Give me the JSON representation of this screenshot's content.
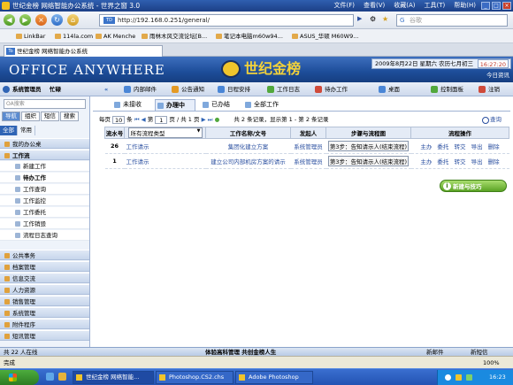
{
  "browser": {
    "title": "世纪金榜 网络智能办公系统 - 世界之窗 3.0",
    "menu": [
      "文件(F)",
      "查看(V)",
      "收藏(A)",
      "工具(T)",
      "帮助(H)"
    ],
    "url": "http://192.168.0.251/general/",
    "search_placeholder": "谷歌",
    "bookmarks": [
      "LinkBar",
      "114la.com",
      "AK Menche",
      "雨林木风交流论坛[B...",
      "笔记本电脑m60w94...",
      "ASUS_华硕 M60W9..."
    ],
    "tab_label": "世纪金榜 网络智能办公系统",
    "status_left": "完成",
    "status_right": "100%"
  },
  "app": {
    "logo": "OFFICE ANYWHERE",
    "brand": "世纪金榜",
    "date": "2009年8月22日 星期六 农历七月初三",
    "time": "16:27:20",
    "today_link": "今日资讯",
    "user_title": "系统管理员",
    "user_home": "忙碌"
  },
  "toolbar": {
    "items": [
      "内部邮件",
      "公告通知",
      "日程安排",
      "工作日志",
      "待办工作"
    ],
    "right": [
      "桌面",
      "控制面板",
      "注销"
    ]
  },
  "leftnav": {
    "search_placeholder": "OA搜索",
    "tabs": [
      "导航",
      "组织",
      "短信",
      "搜索"
    ],
    "subtabs": [
      "全部",
      "常用"
    ],
    "groups_top": [
      "我的办公桌",
      "工作流"
    ],
    "workflow_items": [
      "新建工作",
      "待办工作",
      "工作查询",
      "工作监控",
      "工作委托",
      "工作销毁",
      "流程日志查询"
    ],
    "groups_bottom": [
      "公共事务",
      "档案管理",
      "信息交流",
      "人力资源",
      "销售管理",
      "系统管理",
      "附件程序",
      "短讯管理"
    ]
  },
  "main": {
    "tabs": [
      "未接收",
      "办理中",
      "已办结",
      "全部工作"
    ],
    "pager": {
      "per_page_label": "每页",
      "per_page": "10",
      "unit": "条",
      "page_label": "第",
      "page": "1",
      "pages_text": "页 / 共 1 页",
      "summary": "共 2 条记录，显示第 1 - 第 2 条记录"
    },
    "query_label": "查询",
    "columns": [
      "流水号",
      "所有流程类型",
      "工作名称/文号",
      "发起人",
      "步骤与流程图",
      "流程操作"
    ],
    "rows": [
      {
        "id": "26",
        "type": "工作请示",
        "name": "集团化建立方案",
        "initiator": "系统管理员",
        "step": "第3步：告知请示人(结束流程)",
        "ops": [
          "主办",
          "委托",
          "转交",
          "导出",
          "删除"
        ]
      },
      {
        "id": "1",
        "type": "工作请示",
        "name": "建立公司内部机房方案的请示",
        "initiator": "系统管理员",
        "step": "第3步：告知请示人(结束流程)",
        "ops": [
          "主办",
          "委托",
          "转交",
          "导出",
          "删除"
        ]
      }
    ],
    "new_flow_button": "新建与技巧"
  },
  "footer": {
    "online": "共 22 人在线",
    "slogan": "体验高科管理 共创金榜人生",
    "email": "新邮件",
    "sms": "新短信"
  },
  "taskbar": {
    "items": [
      "世纪金榜 网络智能...",
      "Photoshop.CS2.chs",
      "Adobe Photoshop"
    ],
    "clock": "16:23"
  }
}
